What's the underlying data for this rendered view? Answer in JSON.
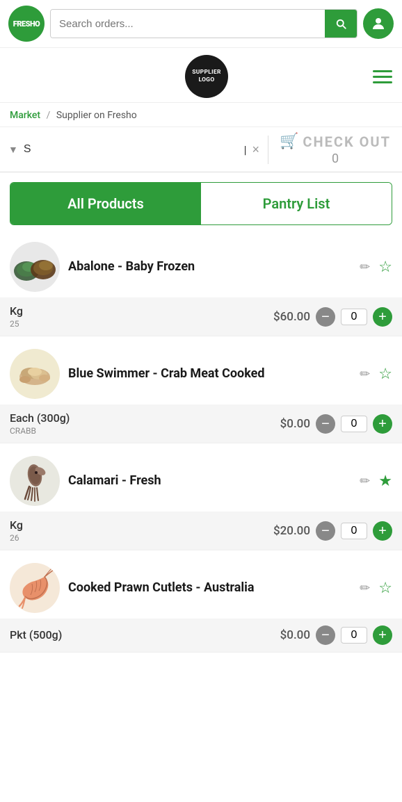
{
  "header": {
    "logo_text": "FRESHO",
    "search_placeholder": "Search orders...",
    "search_value": ""
  },
  "supplier": {
    "logo_line1": "SUPPLIER",
    "logo_line2": "LOGO"
  },
  "breadcrumb": {
    "market": "Market",
    "separator": "/",
    "supplier": "Supplier on Fresho"
  },
  "filter": {
    "input_value": "S",
    "cursor_visible": true,
    "clear_label": "×"
  },
  "checkout": {
    "label": "CHECK OUT",
    "count": "0"
  },
  "tabs": [
    {
      "id": "all-products",
      "label": "All Products",
      "active": true
    },
    {
      "id": "pantry-list",
      "label": "Pantry List",
      "active": false
    }
  ],
  "products": [
    {
      "id": "abalone",
      "name": "Abalone - Baby Frozen",
      "unit": "Kg",
      "sku": "25",
      "price": "$60.00",
      "qty": "0",
      "starred": false,
      "emoji": "🐚"
    },
    {
      "id": "blue-swimmer",
      "name": "Blue Swimmer - Crab Meat Cooked",
      "unit": "Each (300g)",
      "sku": "CRABB",
      "price": "$0.00",
      "qty": "0",
      "starred": false,
      "emoji": "🦀"
    },
    {
      "id": "calamari",
      "name": "Calamari - Fresh",
      "unit": "Kg",
      "sku": "26",
      "price": "$20.00",
      "qty": "0",
      "starred": true,
      "emoji": "🦑"
    },
    {
      "id": "prawn",
      "name": "Cooked Prawn Cutlets - Australia",
      "unit": "Pkt (500g)",
      "sku": "",
      "price": "$0.00",
      "qty": "0",
      "starred": false,
      "emoji": "🦐"
    }
  ],
  "icons": {
    "search": "🔍",
    "cart": "🛒",
    "edit": "✏",
    "star_outline": "☆",
    "star_filled": "★",
    "filter": "▼",
    "hamburger": "☰",
    "user": "👤",
    "minus": "−",
    "plus": "+"
  }
}
